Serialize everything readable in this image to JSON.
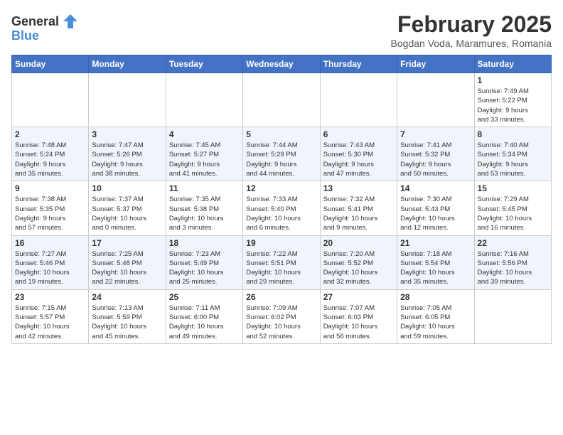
{
  "header": {
    "logo_general": "General",
    "logo_blue": "Blue",
    "month_year": "February 2025",
    "location": "Bogdan Voda, Maramures, Romania"
  },
  "weekdays": [
    "Sunday",
    "Monday",
    "Tuesday",
    "Wednesday",
    "Thursday",
    "Friday",
    "Saturday"
  ],
  "weeks": [
    [
      {
        "day": "",
        "info": ""
      },
      {
        "day": "",
        "info": ""
      },
      {
        "day": "",
        "info": ""
      },
      {
        "day": "",
        "info": ""
      },
      {
        "day": "",
        "info": ""
      },
      {
        "day": "",
        "info": ""
      },
      {
        "day": "1",
        "info": "Sunrise: 7:49 AM\nSunset: 5:22 PM\nDaylight: 9 hours\nand 33 minutes."
      }
    ],
    [
      {
        "day": "2",
        "info": "Sunrise: 7:48 AM\nSunset: 5:24 PM\nDaylight: 9 hours\nand 35 minutes."
      },
      {
        "day": "3",
        "info": "Sunrise: 7:47 AM\nSunset: 5:26 PM\nDaylight: 9 hours\nand 38 minutes."
      },
      {
        "day": "4",
        "info": "Sunrise: 7:45 AM\nSunset: 5:27 PM\nDaylight: 9 hours\nand 41 minutes."
      },
      {
        "day": "5",
        "info": "Sunrise: 7:44 AM\nSunset: 5:29 PM\nDaylight: 9 hours\nand 44 minutes."
      },
      {
        "day": "6",
        "info": "Sunrise: 7:43 AM\nSunset: 5:30 PM\nDaylight: 9 hours\nand 47 minutes."
      },
      {
        "day": "7",
        "info": "Sunrise: 7:41 AM\nSunset: 5:32 PM\nDaylight: 9 hours\nand 50 minutes."
      },
      {
        "day": "8",
        "info": "Sunrise: 7:40 AM\nSunset: 5:34 PM\nDaylight: 9 hours\nand 53 minutes."
      }
    ],
    [
      {
        "day": "9",
        "info": "Sunrise: 7:38 AM\nSunset: 5:35 PM\nDaylight: 9 hours\nand 57 minutes."
      },
      {
        "day": "10",
        "info": "Sunrise: 7:37 AM\nSunset: 5:37 PM\nDaylight: 10 hours\nand 0 minutes."
      },
      {
        "day": "11",
        "info": "Sunrise: 7:35 AM\nSunset: 5:38 PM\nDaylight: 10 hours\nand 3 minutes."
      },
      {
        "day": "12",
        "info": "Sunrise: 7:33 AM\nSunset: 5:40 PM\nDaylight: 10 hours\nand 6 minutes."
      },
      {
        "day": "13",
        "info": "Sunrise: 7:32 AM\nSunset: 5:41 PM\nDaylight: 10 hours\nand 9 minutes."
      },
      {
        "day": "14",
        "info": "Sunrise: 7:30 AM\nSunset: 5:43 PM\nDaylight: 10 hours\nand 12 minutes."
      },
      {
        "day": "15",
        "info": "Sunrise: 7:29 AM\nSunset: 5:45 PM\nDaylight: 10 hours\nand 16 minutes."
      }
    ],
    [
      {
        "day": "16",
        "info": "Sunrise: 7:27 AM\nSunset: 5:46 PM\nDaylight: 10 hours\nand 19 minutes."
      },
      {
        "day": "17",
        "info": "Sunrise: 7:25 AM\nSunset: 5:48 PM\nDaylight: 10 hours\nand 22 minutes."
      },
      {
        "day": "18",
        "info": "Sunrise: 7:23 AM\nSunset: 5:49 PM\nDaylight: 10 hours\nand 25 minutes."
      },
      {
        "day": "19",
        "info": "Sunrise: 7:22 AM\nSunset: 5:51 PM\nDaylight: 10 hours\nand 29 minutes."
      },
      {
        "day": "20",
        "info": "Sunrise: 7:20 AM\nSunset: 5:52 PM\nDaylight: 10 hours\nand 32 minutes."
      },
      {
        "day": "21",
        "info": "Sunrise: 7:18 AM\nSunset: 5:54 PM\nDaylight: 10 hours\nand 35 minutes."
      },
      {
        "day": "22",
        "info": "Sunrise: 7:16 AM\nSunset: 5:56 PM\nDaylight: 10 hours\nand 39 minutes."
      }
    ],
    [
      {
        "day": "23",
        "info": "Sunrise: 7:15 AM\nSunset: 5:57 PM\nDaylight: 10 hours\nand 42 minutes."
      },
      {
        "day": "24",
        "info": "Sunrise: 7:13 AM\nSunset: 5:59 PM\nDaylight: 10 hours\nand 45 minutes."
      },
      {
        "day": "25",
        "info": "Sunrise: 7:11 AM\nSunset: 6:00 PM\nDaylight: 10 hours\nand 49 minutes."
      },
      {
        "day": "26",
        "info": "Sunrise: 7:09 AM\nSunset: 6:02 PM\nDaylight: 10 hours\nand 52 minutes."
      },
      {
        "day": "27",
        "info": "Sunrise: 7:07 AM\nSunset: 6:03 PM\nDaylight: 10 hours\nand 56 minutes."
      },
      {
        "day": "28",
        "info": "Sunrise: 7:05 AM\nSunset: 6:05 PM\nDaylight: 10 hours\nand 59 minutes."
      },
      {
        "day": "",
        "info": ""
      }
    ]
  ]
}
